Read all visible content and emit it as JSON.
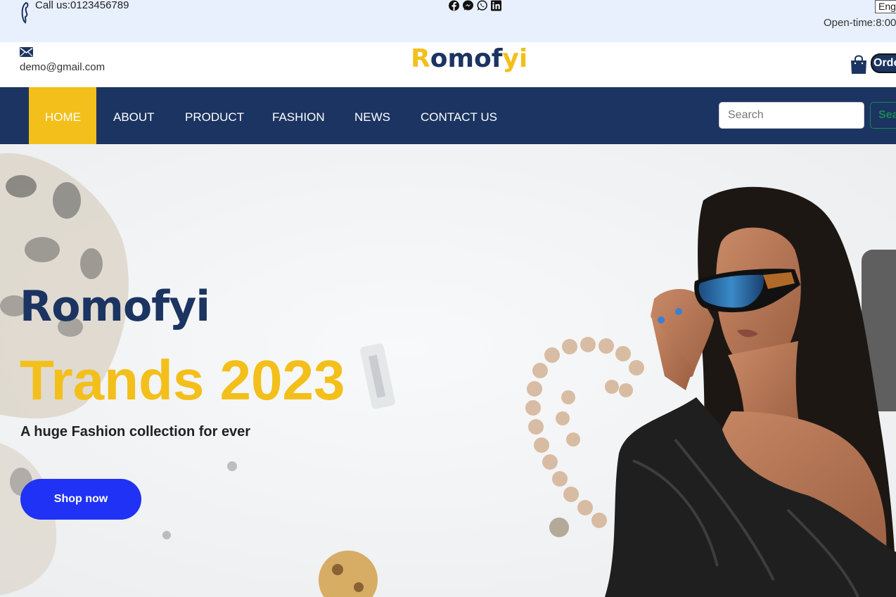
{
  "topbar": {
    "call_text": "Call us:0123456789",
    "language": "Eng",
    "open_time": "Open-time:8:00",
    "socials": [
      "facebook-icon",
      "messenger-icon",
      "whatsapp-icon",
      "linkedin-icon"
    ]
  },
  "header": {
    "email": "demo@gmail.com",
    "logo_first": "R",
    "logo_mid": "omof",
    "logo_y": "y",
    "logo_last": "i",
    "order_label": "Order"
  },
  "nav": {
    "items": [
      {
        "label": "HOME",
        "active": true
      },
      {
        "label": "ABOUT",
        "active": false
      },
      {
        "label": "PRODUCT",
        "active": false
      },
      {
        "label": "FASHION",
        "active": false
      },
      {
        "label": "NEWS",
        "active": false
      },
      {
        "label": "CONTACT US",
        "active": false
      }
    ],
    "search_placeholder": "Search",
    "search_button": "Search"
  },
  "hero": {
    "brand": "Romofyi",
    "headline": "Trands 2023",
    "tagline": "A huge Fashion collection for ever",
    "cta": "Shop now"
  },
  "colors": {
    "navy": "#1b3461",
    "yellow": "#f3bf1a",
    "cta_blue": "#1f32f5",
    "topbar_bg": "#e8f0fd"
  }
}
